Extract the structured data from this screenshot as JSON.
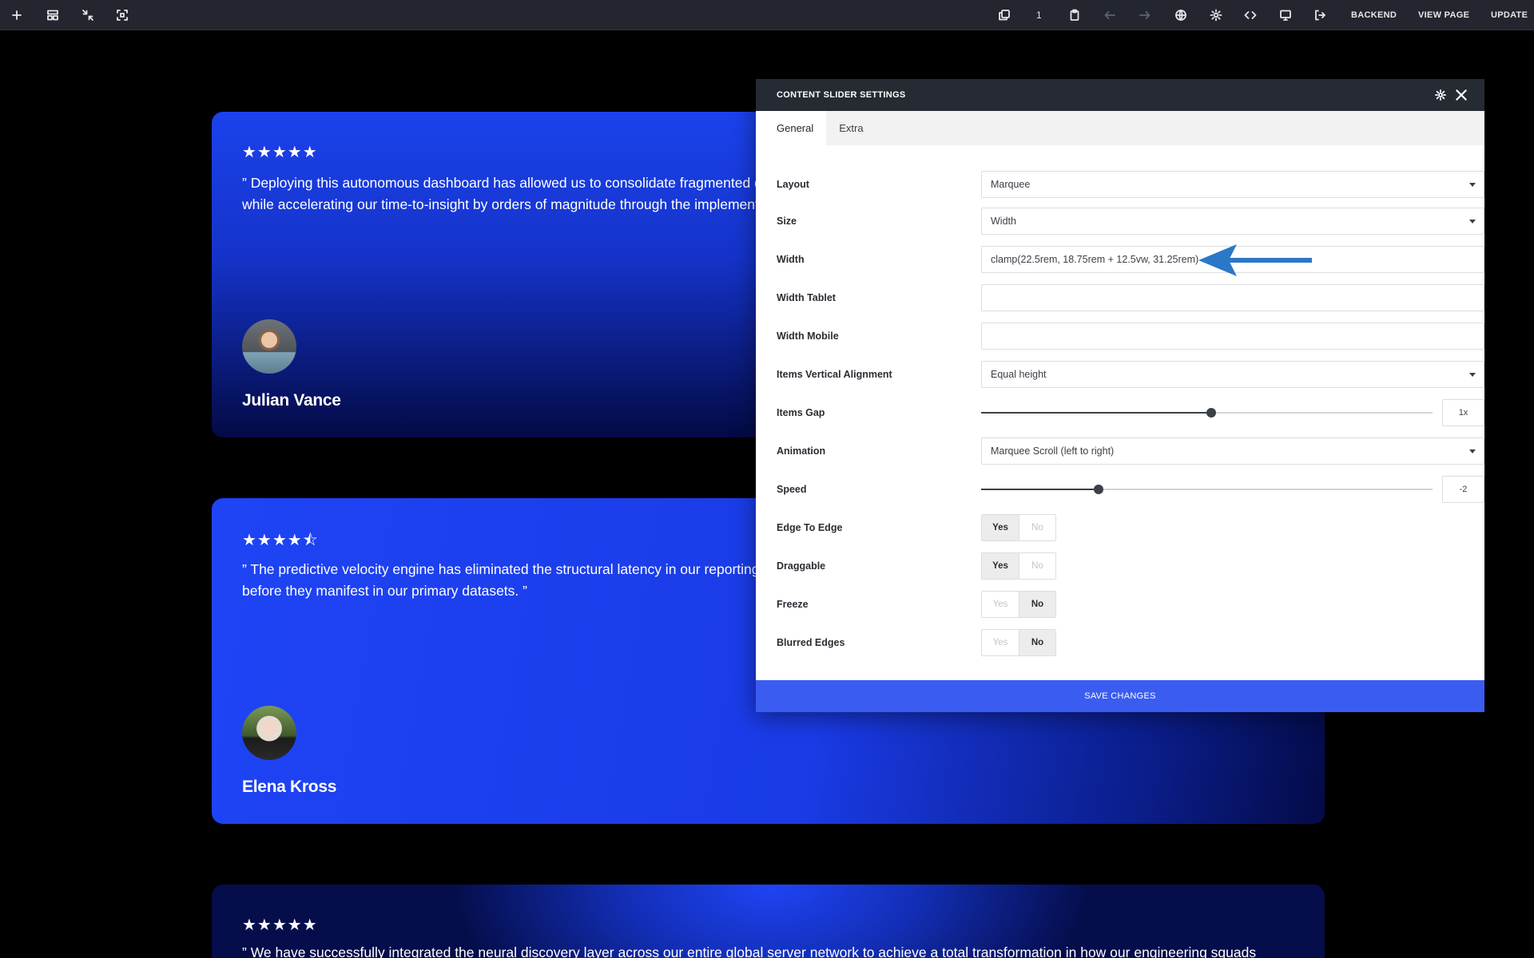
{
  "toolbar": {
    "left_icons": [
      "plus-icon",
      "layout-icon",
      "collapse-icon",
      "select-icon"
    ],
    "revision_count": "1",
    "backend_label": "BACKEND",
    "view_page_label": "VIEW PAGE",
    "update_label": "UPDATE"
  },
  "testimonials": [
    {
      "rating": 5,
      "stars": "★★★★★",
      "quote": "” Deploying this autonomous dashboard has allowed us to consolidate fragmented da\nwhile accelerating our time-to-insight by orders of magnitude through the implementa",
      "name": "Julian Vance"
    },
    {
      "rating": 4.5,
      "stars": "★★★★⯪",
      "quote": "” The predictive velocity engine has eliminated the structural latency in our reporting c\nbefore they manifest in our primary datasets. ”",
      "name": "Elena Kross"
    },
    {
      "rating": 5,
      "stars": "★★★★★",
      "quote": "” We have successfully integrated the neural discovery layer across our entire global server network to achieve a total transformation in how our engineering squads monitor"
    }
  ],
  "modal": {
    "title": "CONTENT SLIDER SETTINGS",
    "tabs": [
      "General",
      "Extra"
    ],
    "active_tab": "General",
    "fields": {
      "layout": {
        "label": "Layout",
        "value": "Marquee"
      },
      "size": {
        "label": "Size",
        "value": "Width"
      },
      "width": {
        "label": "Width",
        "value": "clamp(22.5rem, 18.75rem + 12.5vw, 31.25rem)"
      },
      "width_tablet": {
        "label": "Width Tablet",
        "value": ""
      },
      "width_mobile": {
        "label": "Width Mobile",
        "value": ""
      },
      "items_vertical_alignment": {
        "label": "Items Vertical Alignment",
        "value": "Equal height"
      },
      "items_gap": {
        "label": "Items Gap",
        "value": "1x",
        "slider_fraction": 0.51
      },
      "animation": {
        "label": "Animation",
        "value": "Marquee Scroll (left to right)"
      },
      "speed": {
        "label": "Speed",
        "value": "-2",
        "slider_fraction": 0.26
      },
      "edge_to_edge": {
        "label": "Edge To Edge",
        "value": "Yes"
      },
      "draggable": {
        "label": "Draggable",
        "value": "Yes"
      },
      "freeze": {
        "label": "Freeze",
        "value": "No"
      },
      "blurred_edges": {
        "label": "Blurred Edges",
        "value": "No"
      }
    },
    "toggle_yes": "Yes",
    "toggle_no": "No",
    "save_label": "SAVE CHANGES"
  },
  "colors": {
    "toolbar_bg": "#23262e",
    "accent": "#3a5cf0",
    "card_blue": "#1b42ec",
    "annotation_arrow": "#2a78c8"
  }
}
